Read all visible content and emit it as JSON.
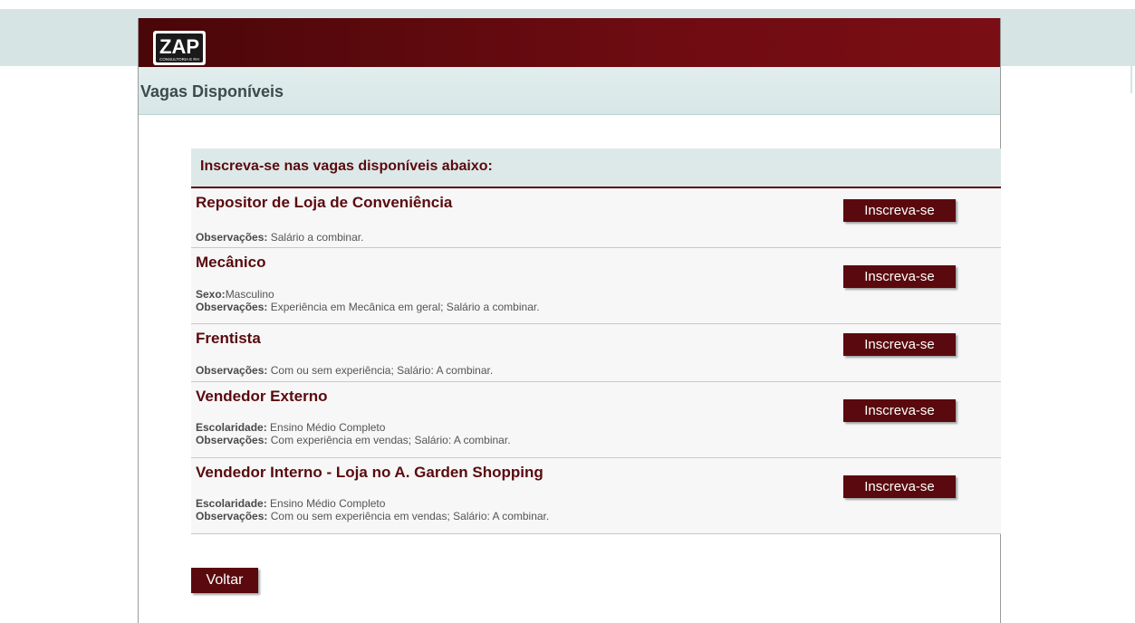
{
  "header": {
    "logo_text": "ZAP",
    "logo_subtext": "CONSULTORIA E RH"
  },
  "page_title": "Vagas Disponíveis",
  "intro": "Inscreva-se nas vagas disponíveis abaixo:",
  "jobs": [
    {
      "title": "Repositor de Loja de Conveniência",
      "details": [
        {
          "label": "Observações:",
          "value": " Salário a combinar."
        }
      ],
      "apply_label": "Inscreva-se"
    },
    {
      "title": "Mecânico",
      "details": [
        {
          "label": "Sexo:",
          "value": "Masculino"
        },
        {
          "label": "Observações:",
          "value": " Experiência em Mecânica em geral; Salário a combinar."
        }
      ],
      "apply_label": "Inscreva-se"
    },
    {
      "title": "Frentista",
      "details": [
        {
          "label": "Observações:",
          "value": " Com ou sem experiência; Salário: A combinar."
        }
      ],
      "apply_label": "Inscreva-se"
    },
    {
      "title": "Vendedor Externo",
      "details": [
        {
          "label": "Escolaridade:",
          "value": " Ensino Médio Completo"
        },
        {
          "label": "Observações:",
          "value": " Com experiência em vendas; Salário: A combinar."
        }
      ],
      "apply_label": "Inscreva-se"
    },
    {
      "title": "Vendedor Interno - Loja no A. Garden Shopping",
      "details": [
        {
          "label": "Escolaridade:",
          "value": " Ensino Médio Completo"
        },
        {
          "label": "Observações:",
          "value": " Com ou sem experiência em vendas; Salário: A combinar."
        }
      ],
      "apply_label": "Inscreva-se"
    }
  ],
  "back_label": "Voltar",
  "colors": {
    "brand": "#5a0a0e",
    "header_bg": "#7a0e14",
    "title_bar_bg": "#dde9e9"
  }
}
